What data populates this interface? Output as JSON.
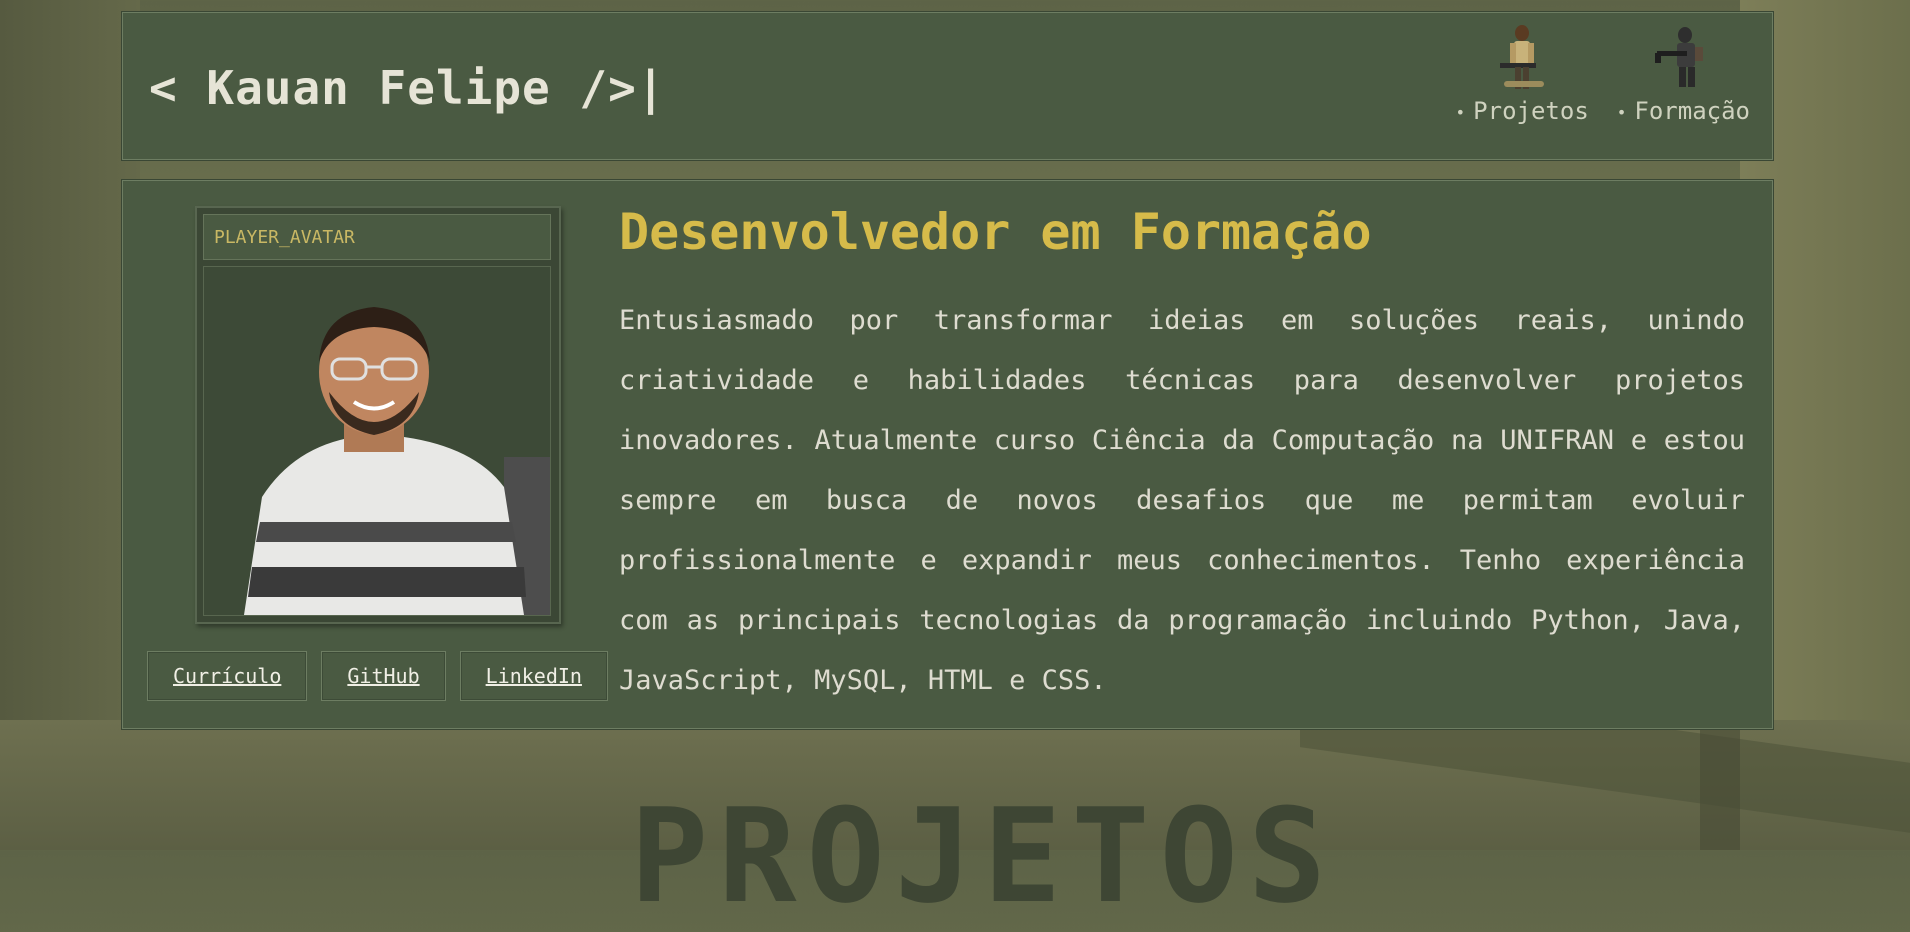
{
  "header": {
    "brand": "< Kauan Felipe />|",
    "nav": [
      {
        "label": "Projetos",
        "icon": "soldier-icon"
      },
      {
        "label": "Formação",
        "icon": "gunner-icon"
      }
    ]
  },
  "profile": {
    "avatar_title": "PLAYER_AVATAR",
    "buttons": [
      "Currículo",
      "GitHub",
      "LinkedIn"
    ],
    "headline": "Desenvolvedor em Formação",
    "bio": "Entusiasmado por transformar ideias em soluções reais, unindo criatividade e habilidades técnicas para desenvolver projetos inovadores. Atualmente curso Ciência da Computação na UNIFRAN e estou sempre em busca de novos desafios que me permitam evoluir profissionalmente e expandir meus conhecimentos. Tenho experiência com as principais tecnologias da programação incluindo Python, Java, JavaScript, MySQL, HTML e CSS."
  },
  "section": {
    "title": "PROJETOS"
  },
  "colors": {
    "panel": "#4a5a42",
    "accent": "#d6bb4a",
    "text": "#dedcd0"
  }
}
